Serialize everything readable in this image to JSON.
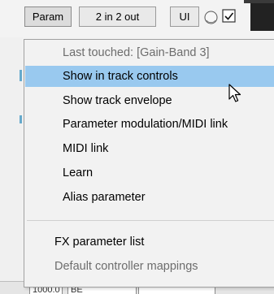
{
  "toolbar": {
    "param_label": "Param",
    "io_label": "2 in 2 out",
    "ui_label": "UI"
  },
  "menu": {
    "header": "Last touched: [Gain-Band 3]",
    "items": [
      "Show in track controls",
      "Show track envelope",
      "Parameter modulation/MIDI link",
      "MIDI link",
      "Learn",
      "Alias parameter"
    ],
    "items2": [
      "FX parameter list",
      "Default controller mappings"
    ],
    "highlighted": "Show in track controls"
  },
  "bottom": {
    "field1": "1000.0",
    "field2": "BE"
  },
  "colors": {
    "highlight": "#99c9ef",
    "menu_bg": "#f2f2f2",
    "disabled_text": "#6d6d6d"
  },
  "icons": {
    "knob": "knob-icon",
    "checkbox": "checkbox-icon",
    "cursor": "mouse-pointer-icon"
  }
}
